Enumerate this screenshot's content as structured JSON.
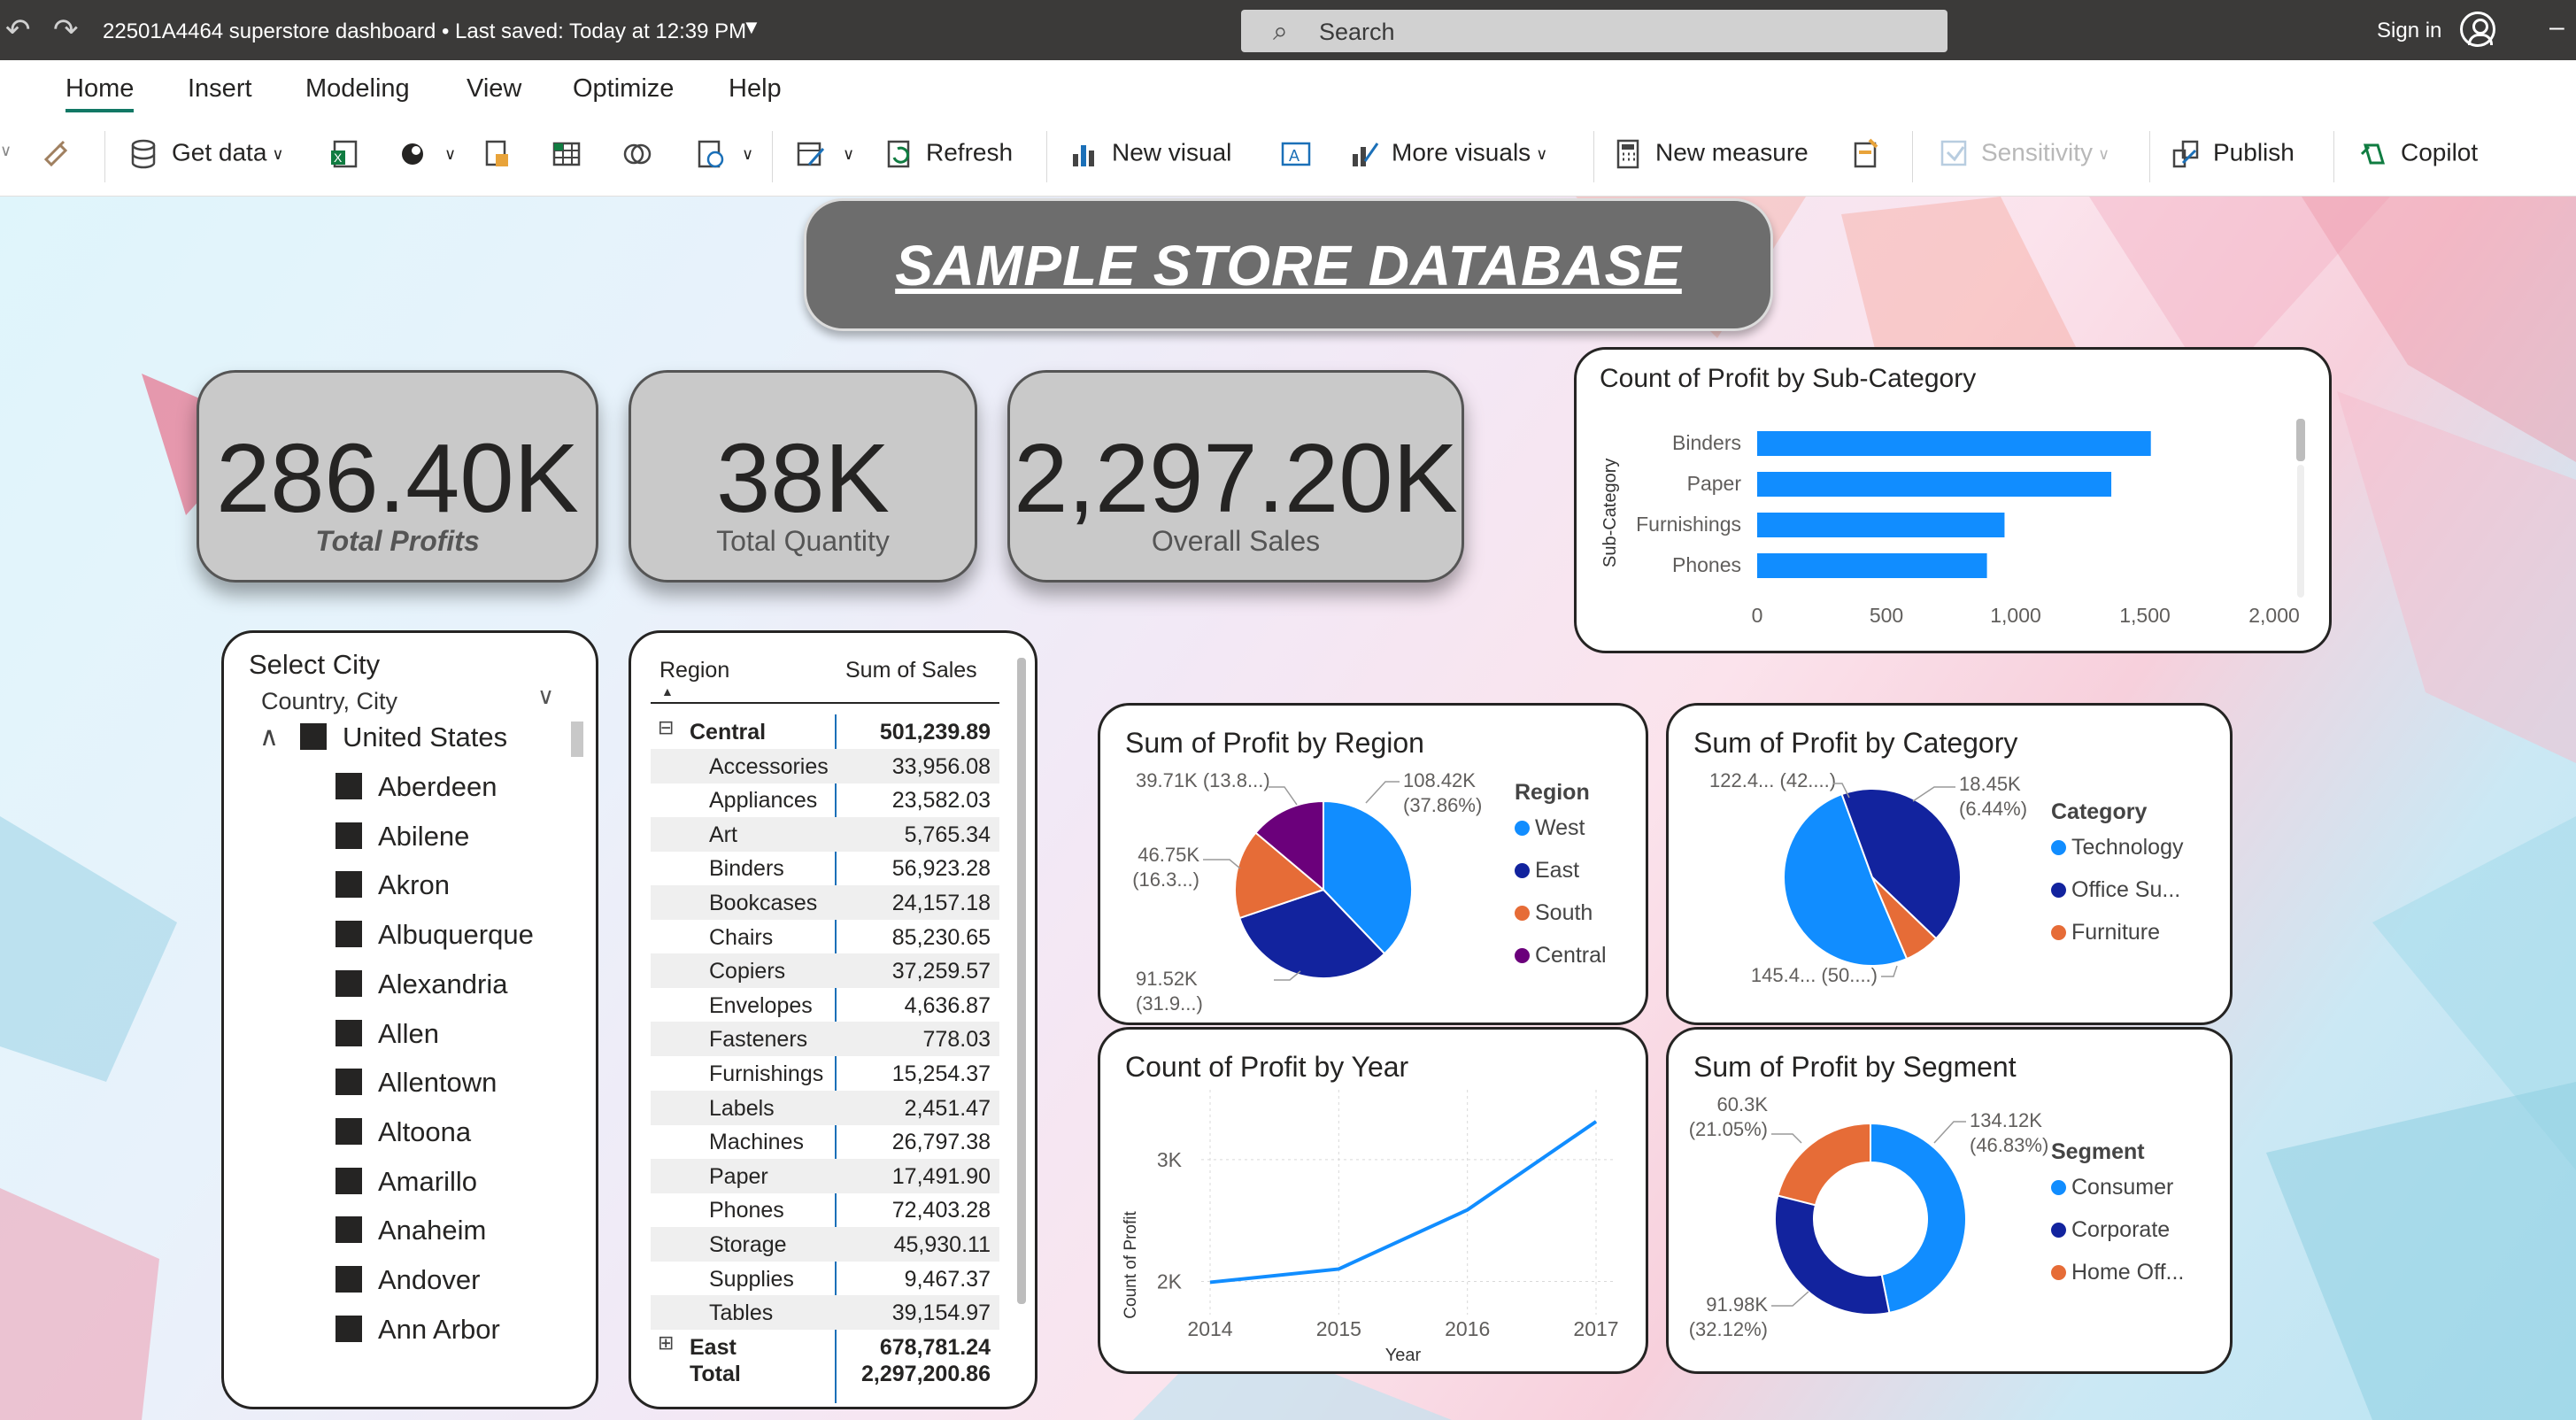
{
  "titlebar": {
    "doc_title": "22501A4464 superstore dashboard • Last saved: Today at 12:39 PM",
    "search_label": "Search",
    "signin_label": "Sign in"
  },
  "menu": {
    "tabs": [
      "Home",
      "Insert",
      "Modeling",
      "View",
      "Optimize",
      "Help"
    ]
  },
  "ribbon": {
    "get_data": "Get data",
    "refresh": "Refresh",
    "new_visual": "New visual",
    "more_visuals": "More visuals",
    "new_measure": "New measure",
    "sensitivity": "Sensitivity",
    "publish": "Publish",
    "copilot": "Copilot"
  },
  "banner": {
    "title": "SAMPLE STORE DATABASE"
  },
  "kpis": [
    {
      "value": "286.40K",
      "label": "Total Profits"
    },
    {
      "value": "38K",
      "label": "Total Quantity"
    },
    {
      "value": "2,297.20K",
      "label": "Overall Sales"
    }
  ],
  "slicer": {
    "title": "Select City",
    "subtitle": "Country, City",
    "country": "United States",
    "cities": [
      "Aberdeen",
      "Abilene",
      "Akron",
      "Albuquerque",
      "Alexandria",
      "Allen",
      "Allentown",
      "Altoona",
      "Amarillo",
      "Anaheim",
      "Andover",
      "Ann Arbor"
    ]
  },
  "matrix": {
    "col_region": "Region",
    "col_sales": "Sum of Sales",
    "group1": {
      "label": "Central",
      "value": "501,239.89"
    },
    "rows": [
      {
        "label": "Accessories",
        "value": "33,956.08"
      },
      {
        "label": "Appliances",
        "value": "23,582.03"
      },
      {
        "label": "Art",
        "value": "5,765.34"
      },
      {
        "label": "Binders",
        "value": "56,923.28"
      },
      {
        "label": "Bookcases",
        "value": "24,157.18"
      },
      {
        "label": "Chairs",
        "value": "85,230.65"
      },
      {
        "label": "Copiers",
        "value": "37,259.57"
      },
      {
        "label": "Envelopes",
        "value": "4,636.87"
      },
      {
        "label": "Fasteners",
        "value": "778.03"
      },
      {
        "label": "Furnishings",
        "value": "15,254.37"
      },
      {
        "label": "Labels",
        "value": "2,451.47"
      },
      {
        "label": "Machines",
        "value": "26,797.38"
      },
      {
        "label": "Paper",
        "value": "17,491.90"
      },
      {
        "label": "Phones",
        "value": "72,403.28"
      },
      {
        "label": "Storage",
        "value": "45,930.11"
      },
      {
        "label": "Supplies",
        "value": "9,467.37"
      },
      {
        "label": "Tables",
        "value": "39,154.97"
      }
    ],
    "group2": {
      "label": "East",
      "value": "678,781.24"
    },
    "total": {
      "label": "Total",
      "value": "2,297,200.86"
    }
  },
  "chart_data": [
    {
      "type": "bar",
      "orientation": "horizontal",
      "title": "Count of Profit by Sub-Category",
      "ylabel": "Sub-Category",
      "categories": [
        "Binders",
        "Paper",
        "Furnishings",
        "Phones"
      ],
      "values": [
        1523,
        1370,
        957,
        889
      ],
      "xlim": [
        0,
        2000
      ],
      "xticks": [
        "0",
        "500",
        "1,000",
        "1,500",
        "2,000"
      ],
      "color": "#118DFF"
    },
    {
      "type": "pie",
      "title": "Sum of Profit by Region",
      "legend_title": "Region",
      "labels": [
        "West",
        "East",
        "South",
        "Central"
      ],
      "values": [
        108.42,
        91.52,
        46.75,
        39.71
      ],
      "data_labels": [
        "108.42K (37.86%)",
        "91.52K (31.9...)",
        "46.75K (16.3...)",
        "39.71K (13.8...)"
      ],
      "colors": [
        "#118DFF",
        "#12239E",
        "#E66C37",
        "#6B007B"
      ]
    },
    {
      "type": "pie",
      "title": "Sum of Profit by Category",
      "legend_title": "Category",
      "labels": [
        "Technology",
        "Office Su...",
        "Furniture"
      ],
      "values": [
        145.4,
        122.4,
        18.45
      ],
      "data_labels": [
        "145.4... (50....)",
        "122.4... (42....)",
        "18.45K (6.44%)"
      ],
      "colors": [
        "#118DFF",
        "#12239E",
        "#E66C37"
      ]
    },
    {
      "type": "line",
      "title": "Count of Profit by Year",
      "xlabel": "Year",
      "ylabel": "Count of Profit",
      "x": [
        2014,
        2015,
        2016,
        2017
      ],
      "y": [
        1993,
        2102,
        2587,
        3312
      ],
      "ylim": [
        1800,
        3500
      ],
      "yticks": [
        "2K",
        "3K"
      ],
      "color": "#118DFF"
    },
    {
      "type": "donut",
      "title": "Sum of Profit by Segment",
      "legend_title": "Segment",
      "labels": [
        "Consumer",
        "Corporate",
        "Home Off..."
      ],
      "values": [
        134.12,
        91.98,
        60.3
      ],
      "data_labels": [
        "134.12K (46.83%)",
        "91.98K (32.12%)",
        "60.3K (21.05%)"
      ],
      "colors": [
        "#118DFF",
        "#12239E",
        "#E66C37"
      ]
    }
  ]
}
